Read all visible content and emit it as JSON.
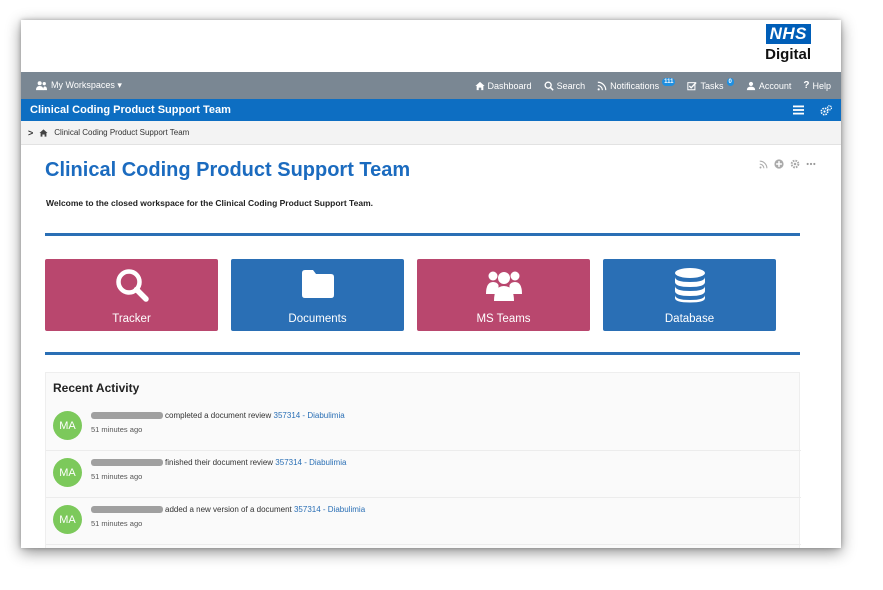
{
  "brand": {
    "nhs": "NHS",
    "digital": "Digital"
  },
  "topnav": {
    "workspaces": "My Workspaces ▾",
    "dashboard": "Dashboard",
    "search": "Search",
    "notifications": "Notifications",
    "notifications_count": "111",
    "tasks": "Tasks",
    "tasks_count": "0",
    "account": "Account",
    "help": "Help"
  },
  "titlebar": {
    "title": "Clinical Coding Product Support Team"
  },
  "breadcrumb": {
    "chevron": ">",
    "item": "Clinical Coding Product Support Team"
  },
  "main": {
    "title": "Clinical Coding Product Support Team",
    "welcome": "Welcome to the closed workspace for the Clinical Coding Product Support Team."
  },
  "tiles": [
    {
      "label": "Tracker",
      "color": "#b9476e"
    },
    {
      "label": "Documents",
      "color": "#2a6fb5"
    },
    {
      "label": "MS Teams",
      "color": "#b9476e"
    },
    {
      "label": "Database",
      "color": "#2a6fb5"
    }
  ],
  "activity": {
    "heading": "Recent Activity",
    "items": [
      {
        "initials": "MA",
        "action": "completed a document review",
        "link": "357314 - Diabulimia",
        "time": "51 minutes ago"
      },
      {
        "initials": "MA",
        "action": "finished their document review",
        "link": "357314 - Diabulimia",
        "time": "51 minutes ago"
      },
      {
        "initials": "MA",
        "action": "added a new version of a document",
        "link": "357314 - Diabulimia",
        "time": "51 minutes ago"
      }
    ]
  },
  "colors": {
    "nav_gray": "#7a8793",
    "title_blue": "#0d6ec2",
    "avatar_green": "#7cc95b"
  }
}
